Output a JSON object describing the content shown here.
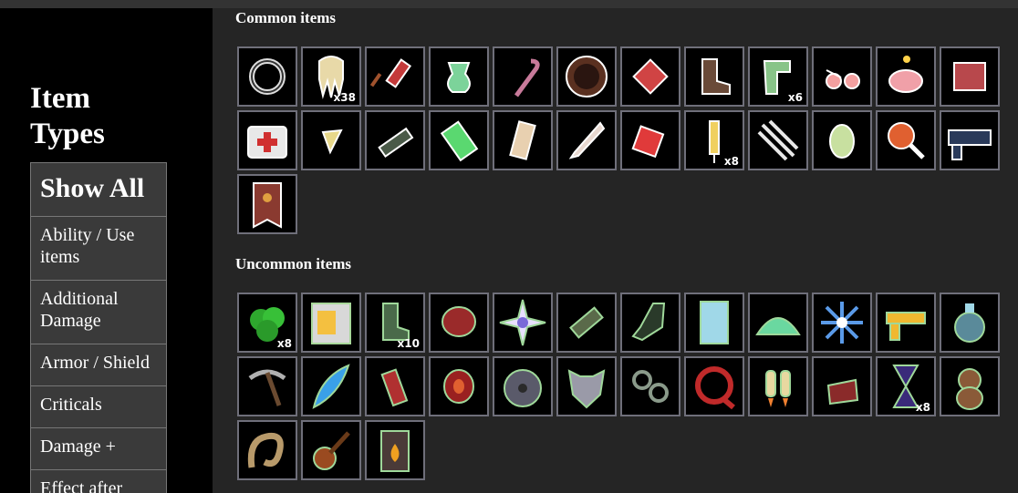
{
  "sidebar": {
    "title_line1": "Item",
    "title_line2": "Types",
    "filters": [
      "Show All",
      "Ability / Use items",
      "Additional Damage",
      "Armor / Shield",
      "Criticals",
      "Damage +",
      "Effect after"
    ]
  },
  "colors": {
    "common_outline": "#ffffff",
    "uncommon_outline": "#9fd89a",
    "tile_border": "#6f6f7a"
  },
  "sections": [
    {
      "title": "Common items",
      "items": [
        {
          "icon": "spiked-ring-icon",
          "qty": ""
        },
        {
          "icon": "squid-icon",
          "qty": "x38"
        },
        {
          "icon": "firework-icon",
          "qty": ""
        },
        {
          "icon": "green-pouch-icon",
          "qty": ""
        },
        {
          "icon": "cane-icon",
          "qty": ""
        },
        {
          "icon": "round-mirror-icon",
          "qty": ""
        },
        {
          "icon": "red-gem-icon",
          "qty": ""
        },
        {
          "icon": "boot-icon",
          "qty": ""
        },
        {
          "icon": "green-hook-icon",
          "qty": "x6"
        },
        {
          "icon": "glasses-icon",
          "qty": ""
        },
        {
          "icon": "piggy-bank-icon",
          "qty": ""
        },
        {
          "icon": "red-cube-icon",
          "qty": ""
        },
        {
          "icon": "medkit-icon",
          "qty": ""
        },
        {
          "icon": "arrowhead-icon",
          "qty": ""
        },
        {
          "icon": "launcher-icon",
          "qty": ""
        },
        {
          "icon": "battery-icon",
          "qty": ""
        },
        {
          "icon": "bandaged-arm-icon",
          "qty": ""
        },
        {
          "icon": "knife-icon",
          "qty": ""
        },
        {
          "icon": "red-dice-icon",
          "qty": ""
        },
        {
          "icon": "syringe-icon",
          "qty": "x8"
        },
        {
          "icon": "dna-chain-icon",
          "qty": ""
        },
        {
          "icon": "green-egg-icon",
          "qty": ""
        },
        {
          "icon": "magnifier-icon",
          "qty": ""
        },
        {
          "icon": "blaster-gun-icon",
          "qty": ""
        },
        {
          "icon": "banner-icon",
          "qty": ""
        }
      ]
    },
    {
      "title": "Uncommon items",
      "items": [
        {
          "icon": "bush-icon",
          "qty": "x8"
        },
        {
          "icon": "vending-machine-icon",
          "qty": ""
        },
        {
          "icon": "green-boot-icon",
          "qty": "x10"
        },
        {
          "icon": "boxing-glove-icon",
          "qty": ""
        },
        {
          "icon": "star-burst-icon",
          "qty": ""
        },
        {
          "icon": "log-icon",
          "qty": ""
        },
        {
          "icon": "dark-boot-icon",
          "qty": ""
        },
        {
          "icon": "glass-panel-icon",
          "qty": ""
        },
        {
          "icon": "green-mound-icon",
          "qty": ""
        },
        {
          "icon": "snowflake-icon",
          "qty": ""
        },
        {
          "icon": "golden-pistol-icon",
          "qty": ""
        },
        {
          "icon": "potion-sack-icon",
          "qty": ""
        },
        {
          "icon": "pickaxe-icon",
          "qty": ""
        },
        {
          "icon": "blue-feather-icon",
          "qty": ""
        },
        {
          "icon": "red-canister-icon",
          "qty": ""
        },
        {
          "icon": "meat-icon",
          "qty": ""
        },
        {
          "icon": "saw-blade-icon",
          "qty": ""
        },
        {
          "icon": "wolf-head-icon",
          "qty": ""
        },
        {
          "icon": "chain-links-icon",
          "qty": ""
        },
        {
          "icon": "red-hose-icon",
          "qty": ""
        },
        {
          "icon": "jetpack-icon",
          "qty": ""
        },
        {
          "icon": "red-pouch-icon",
          "qty": ""
        },
        {
          "icon": "hourglass-icon",
          "qty": "x8"
        },
        {
          "icon": "teddy-bear-icon",
          "qty": ""
        },
        {
          "icon": "worm-icon",
          "qty": ""
        },
        {
          "icon": "guitar-icon",
          "qty": ""
        },
        {
          "icon": "fire-jar-icon",
          "qty": ""
        }
      ]
    }
  ]
}
